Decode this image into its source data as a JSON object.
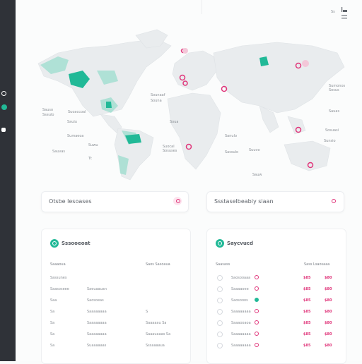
{
  "colors": {
    "accent_teal": "#21b997",
    "accent_pink": "#e0357a",
    "sidebar": "#2f3238"
  },
  "sidebar": {
    "icons": [
      "info-icon",
      "status-dot-icon",
      "window-icon"
    ]
  },
  "corner_icon": "chart-icon",
  "map": {
    "labels": [
      "Sauso",
      "Sseulo",
      "Suoaccoal",
      "Sauiu",
      "Sumaeoa",
      "Suwu",
      "Sauvas",
      "Tt",
      "Sounaaf",
      "Souna",
      "Soua",
      "Suocal",
      "Sosuses",
      "Sanulo",
      "Sassulo",
      "Suuvo",
      "Sauw",
      "Sumonos",
      "Sosus",
      "Sauas",
      "Sosuasi",
      "Sunsio",
      "Ss"
    ]
  },
  "search_left": {
    "text": "Otsbe lesoases"
  },
  "search_right": {
    "text": "Ssstaselbeabiy siaan"
  },
  "left_card": {
    "title": "Sssooeoat",
    "header": [
      "Saaaoua",
      "Saos Sasoaua"
    ],
    "rows": [
      [
        "Sassunes",
        "",
        ""
      ],
      [
        "Saasoseee",
        "Saeuaauan",
        ""
      ],
      [
        "Saa",
        "Saosoeas",
        ""
      ],
      [
        "Sa",
        "Saaaaaaaa",
        "S"
      ],
      [
        "Sa",
        "Saaaaaaaa",
        "Saaaaau Sa"
      ],
      [
        "Sa",
        "Saaaaaaaa",
        "Saaauaaas Sa"
      ],
      [
        "Sa",
        "Suaaaaaas",
        "Sssaaaaua"
      ]
    ]
  },
  "right_card": {
    "title": "Saycvucd",
    "header": [
      "Saasass",
      "Sass Lsaosaaa"
    ],
    "rows": [
      [
        "Saosooaaa",
        "pink",
        "$85",
        "$80"
      ],
      [
        "Saaaaoee",
        "pink",
        "$85",
        "$80"
      ],
      [
        "Saosooos",
        "teal",
        "$85",
        "$80"
      ],
      [
        "Saaaaaaaa",
        "pink",
        "$85",
        "$80"
      ],
      [
        "Saaaooaoa",
        "pink",
        "$85",
        "$80"
      ],
      [
        "Saaaaaaaa",
        "pink",
        "$85",
        "$80"
      ],
      [
        "Saaaaaaaa",
        "pink",
        "$85",
        "$80"
      ]
    ]
  }
}
